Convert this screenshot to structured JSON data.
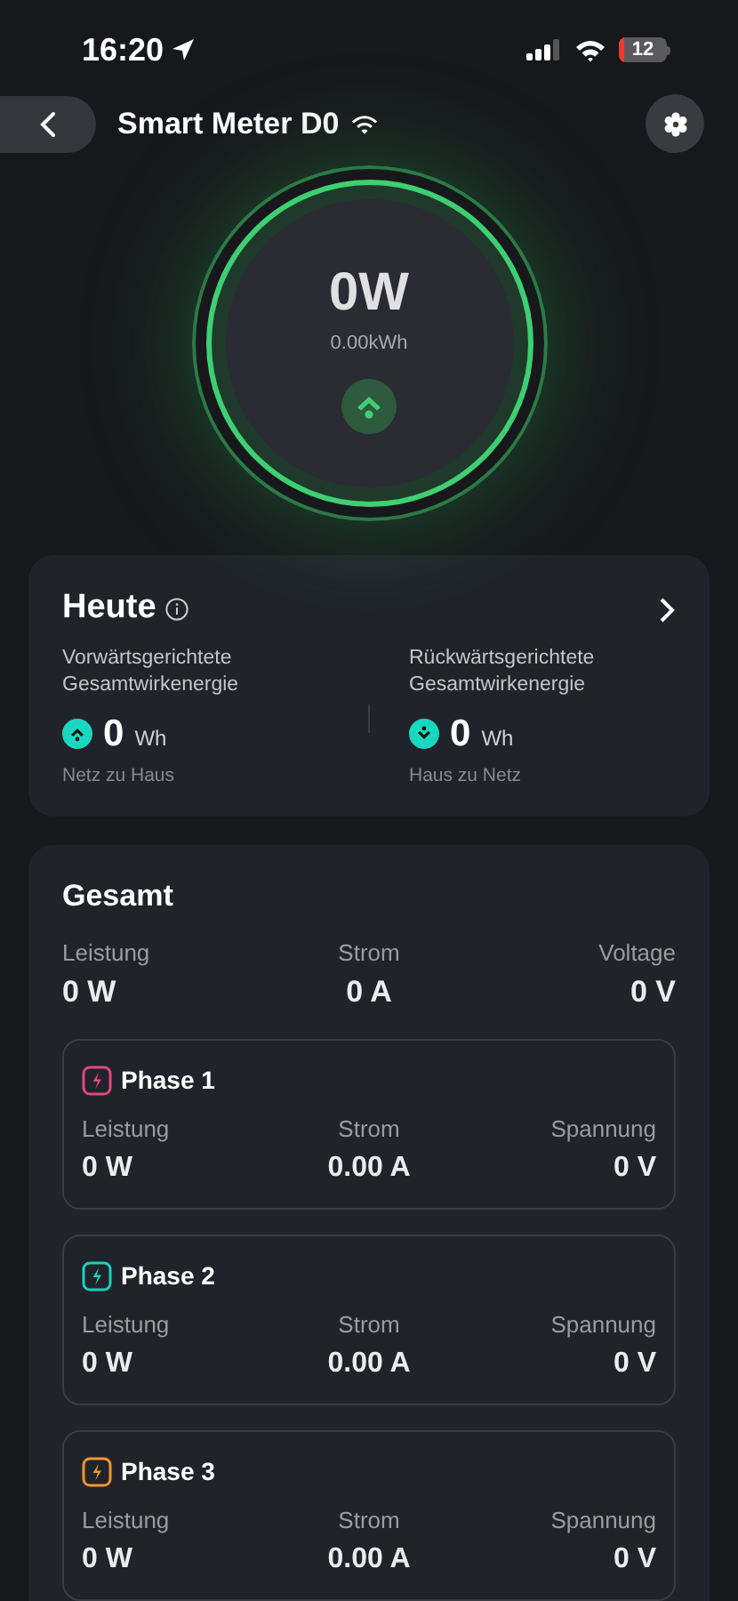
{
  "status_bar": {
    "time": "16:20",
    "battery": "12"
  },
  "header": {
    "title": "Smart Meter D0"
  },
  "gauge": {
    "power": "0W",
    "energy": "0.00kWh"
  },
  "today": {
    "title": "Heute",
    "items": [
      {
        "kind": "import",
        "label": "Vorwärtsgerichtete Gesamtwirkenergie",
        "value": "0",
        "unit": "Wh",
        "caption": "Netz zu Haus"
      },
      {
        "kind": "export",
        "label": "Rückwärtsgerichtete Gesamtwirkenergie",
        "value": "0",
        "unit": "Wh",
        "caption": "Haus zu Netz"
      }
    ]
  },
  "total": {
    "title": "Gesamt",
    "metrics": [
      {
        "label": "Leistung",
        "value": "0 W"
      },
      {
        "label": "Strom",
        "value": "0 A"
      },
      {
        "label": "Voltage",
        "value": "0 V"
      }
    ],
    "phases": [
      {
        "name": "Phase 1",
        "color": "#e04a7a",
        "metrics": [
          {
            "label": "Leistung",
            "value": "0 W"
          },
          {
            "label": "Strom",
            "value": "0.00 A"
          },
          {
            "label": "Spannung",
            "value": "0 V"
          }
        ]
      },
      {
        "name": "Phase 2",
        "color": "#19d3bb",
        "metrics": [
          {
            "label": "Leistung",
            "value": "0 W"
          },
          {
            "label": "Strom",
            "value": "0.00 A"
          },
          {
            "label": "Spannung",
            "value": "0 V"
          }
        ]
      },
      {
        "name": "Phase 3",
        "color": "#f0972f",
        "metrics": [
          {
            "label": "Leistung",
            "value": "0 W"
          },
          {
            "label": "Strom",
            "value": "0.00 A"
          },
          {
            "label": "Spannung",
            "value": "0 V"
          }
        ]
      }
    ]
  }
}
